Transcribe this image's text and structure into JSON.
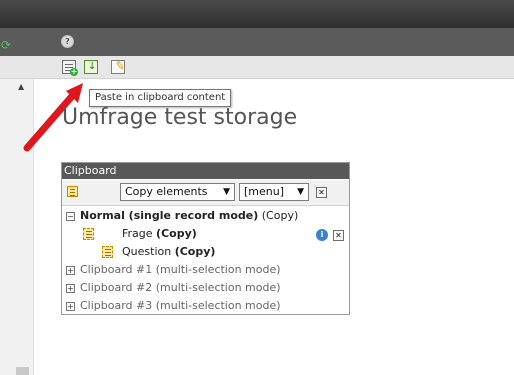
{
  "header": {
    "refresh_icon": "refresh-icon",
    "help_icon": "help-icon"
  },
  "toolbar": {
    "icons": [
      "new-record-icon",
      "paste-clipboard-icon",
      "edit-icon"
    ]
  },
  "tooltip": {
    "text": "Paste in clipboard content"
  },
  "page": {
    "title": "Umfrage test storage"
  },
  "clipboard": {
    "title": "Clipboard",
    "mode_select": "Copy elements",
    "menu_select": "[menu]",
    "normal_pad": {
      "label": "Normal (single record mode)",
      "mode": "(Copy)"
    },
    "items": [
      {
        "name": "Frage",
        "mode": "(Copy)"
      },
      {
        "name": "Question",
        "mode": "(Copy)"
      }
    ],
    "pads": [
      "Clipboard #1 (multi-selection mode)",
      "Clipboard #2 (multi-selection mode)",
      "Clipboard #3 (multi-selection mode)"
    ]
  },
  "colors": {
    "topbar": "#3a3a3a",
    "toolbar": "#e7e7e7",
    "clipboard_header": "#585858",
    "arrow": "#e0161f"
  }
}
